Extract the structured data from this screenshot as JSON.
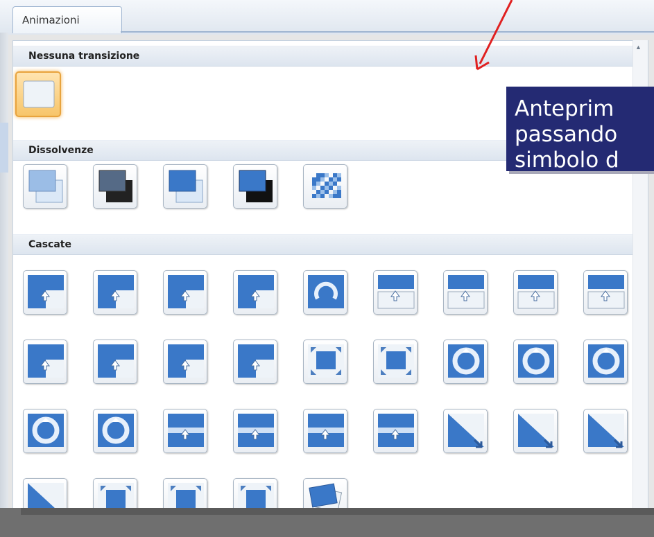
{
  "tab": {
    "label": "Animazioni"
  },
  "sections": {
    "none": "Nessuna transizione",
    "dissolve": "Dissolvenze",
    "wipes": "Cascate"
  },
  "callout": {
    "line1": "Anteprim",
    "line2": "passando",
    "line3": "simbolo d"
  },
  "colors": {
    "accent_blue": "#3a78c8",
    "callout_bg": "#242a73",
    "selection": "#f4b24d",
    "arrow": "#e02020"
  },
  "icons": {
    "none": [
      "blank-slide-icon"
    ],
    "dissolve": [
      "fade-smoothly-icon",
      "fade-through-black-icon",
      "cut-icon",
      "cut-through-black-icon",
      "dissolve-icon"
    ],
    "wipes": [
      "cover-down-icon",
      "cover-left-icon",
      "cover-right-icon",
      "cover-up-icon",
      "newsflash-icon",
      "push-down-icon",
      "push-left-icon",
      "push-right-icon",
      "push-up-icon",
      "cover-left-down-icon",
      "cover-left-up-icon",
      "cover-right-down-icon",
      "cover-right-up-icon",
      "shape-in-icon",
      "shape-out-icon",
      "wheel-1-icon",
      "wheel-2-icon",
      "wheel-3-icon",
      "wheel-4-icon",
      "wheel-8-icon",
      "split-horizontal-in-icon",
      "split-horizontal-out-icon",
      "split-vertical-in-icon",
      "split-vertical-out-icon",
      "strips-left-down-icon",
      "strips-left-up-icon",
      "strips-right-down-icon",
      "strips-right-up-icon",
      "shape-circle-icon",
      "shape-diamond-icon",
      "shape-plus-icon",
      "random-transition-icon"
    ]
  }
}
